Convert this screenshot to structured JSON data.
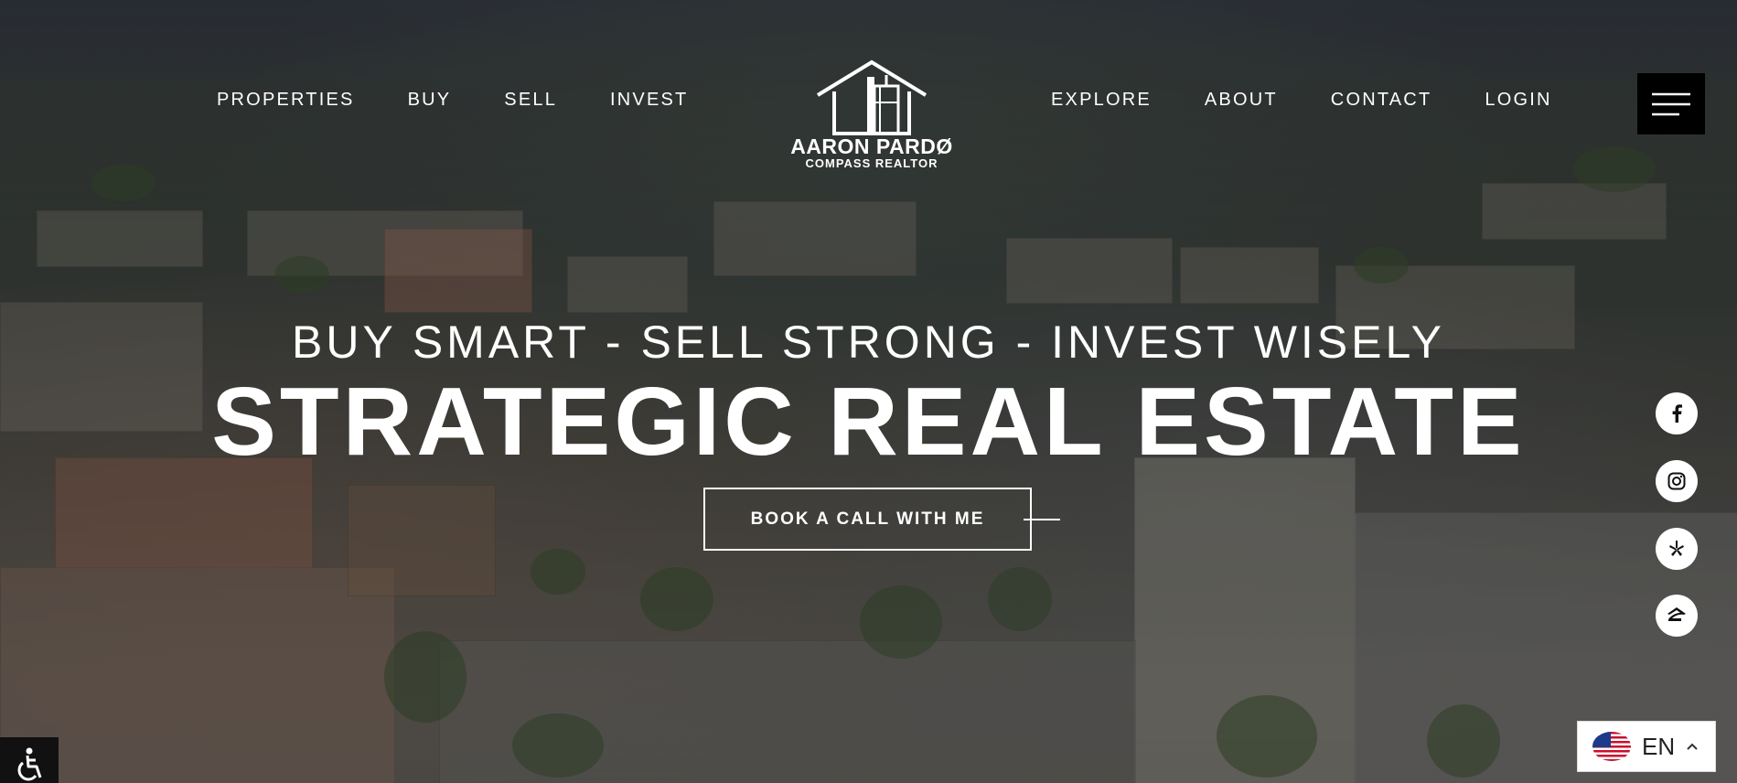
{
  "nav": {
    "left": [
      {
        "label": "PROPERTIES"
      },
      {
        "label": "BUY"
      },
      {
        "label": "SELL"
      },
      {
        "label": "INVEST"
      }
    ],
    "right": [
      {
        "label": "EXPLORE"
      },
      {
        "label": "ABOUT"
      },
      {
        "label": "CONTACT"
      },
      {
        "label": "LOGIN"
      }
    ]
  },
  "logo": {
    "name": "AARON PARDØ",
    "subtitle": "COMPASS REALTOR"
  },
  "hero": {
    "tagline": "BUY SMART - SELL STRONG - INVEST WISELY",
    "headline": "STRATEGIC REAL ESTATE",
    "cta_label": "BOOK A CALL WITH ME"
  },
  "social": [
    {
      "icon": "facebook-icon"
    },
    {
      "icon": "instagram-icon"
    },
    {
      "icon": "yelp-icon"
    },
    {
      "icon": "zillow-icon"
    }
  ],
  "language": {
    "code": "EN",
    "flag": "us-flag-icon"
  },
  "colors": {
    "text": "#ffffff",
    "menu_bg": "#000000",
    "language_bg": "#ffffff"
  }
}
